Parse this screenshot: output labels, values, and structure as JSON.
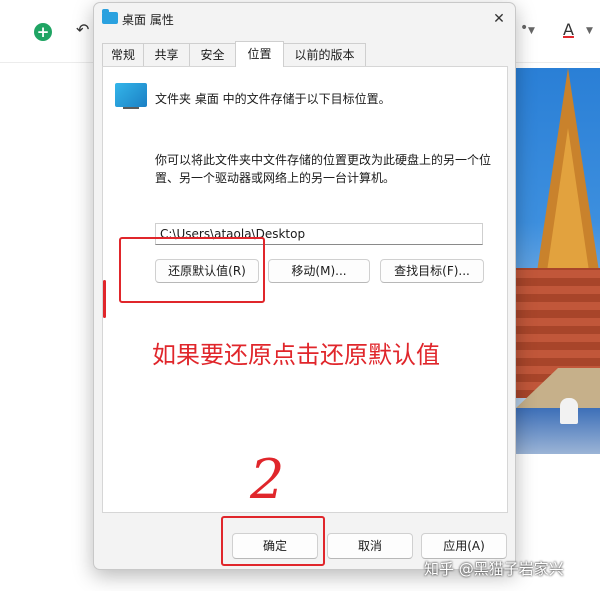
{
  "toolbar": {
    "add_icon": "plus-circle-icon",
    "undo_icon": "undo-icon",
    "font_color_label": "A",
    "font_color_accent": "#e0282e"
  },
  "dialog": {
    "title": "桌面 属性",
    "close_symbol": "✕",
    "tabs": [
      {
        "label": "常规"
      },
      {
        "label": "共享"
      },
      {
        "label": "安全"
      },
      {
        "label": "位置"
      },
      {
        "label": "以前的版本"
      }
    ],
    "active_tab": "位置",
    "location": {
      "info": "文件夹 桌面 中的文件存储于以下目标位置。",
      "description": "你可以将此文件夹中文件存储的位置更改为此硬盘上的另一个位置、另一个驱动器或网络上的另一台计算机。",
      "path_value": "C:\\Users\\ataola\\Desktop",
      "restore_button": "还原默认值(R)",
      "move_button": "移动(M)...",
      "find_target_button": "查找目标(F)..."
    },
    "footer": {
      "ok_button": "确定",
      "cancel_button": "取消",
      "apply_button": "应用(A)"
    }
  },
  "annotations": {
    "note": "如果要还原点击还原默认值",
    "step_number": "2",
    "color": "#e0262b"
  },
  "watermark": "知乎 @黑猫子岩家兴"
}
